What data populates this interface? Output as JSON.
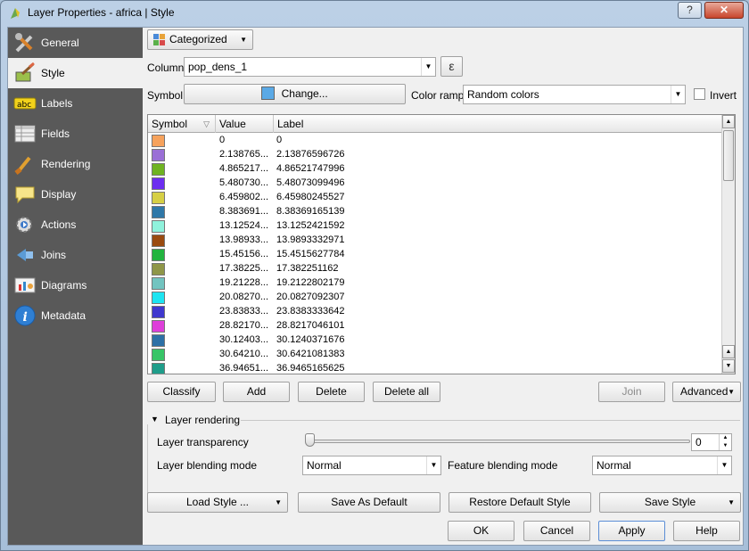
{
  "window": {
    "title": "Layer Properties - africa | Style",
    "help_label": "?",
    "close_label": "✕"
  },
  "sidebar": {
    "items": [
      {
        "label": "General",
        "icon": "general-icon"
      },
      {
        "label": "Style",
        "icon": "style-icon"
      },
      {
        "label": "Labels",
        "icon": "labels-icon"
      },
      {
        "label": "Fields",
        "icon": "fields-icon"
      },
      {
        "label": "Rendering",
        "icon": "rendering-icon"
      },
      {
        "label": "Display",
        "icon": "display-icon"
      },
      {
        "label": "Actions",
        "icon": "actions-icon"
      },
      {
        "label": "Joins",
        "icon": "joins-icon"
      },
      {
        "label": "Diagrams",
        "icon": "diagrams-icon"
      },
      {
        "label": "Metadata",
        "icon": "metadata-icon"
      }
    ],
    "active": "Style"
  },
  "renderer": {
    "type": "Categorized"
  },
  "column": {
    "label": "Column",
    "value": "pop_dens_1",
    "expression_label": "ε"
  },
  "symbol": {
    "label": "Symbol",
    "change_label": "Change...",
    "color": "#5aa9e6"
  },
  "color_ramp": {
    "label": "Color ramp",
    "value": "Random colors",
    "invert_label": "Invert",
    "invert_checked": false
  },
  "table": {
    "headers": [
      "Symbol",
      "Value",
      "Label"
    ],
    "rows": [
      {
        "color": "#f6a25c",
        "value": "0",
        "label": "0"
      },
      {
        "color": "#9a6fd6",
        "value": "2.138765...",
        "label": "2.13876596726"
      },
      {
        "color": "#6fb320",
        "value": "4.865217...",
        "label": "4.86521747996"
      },
      {
        "color": "#6c2df0",
        "value": "5.480730...",
        "label": "5.48073099496"
      },
      {
        "color": "#d6cf45",
        "value": "6.459802...",
        "label": "6.45980245527"
      },
      {
        "color": "#2f78a8",
        "value": "8.383691...",
        "label": "8.38369165139"
      },
      {
        "color": "#8ff2dc",
        "value": "13.12524...",
        "label": "13.1252421592"
      },
      {
        "color": "#9a4a10",
        "value": "13.98933...",
        "label": "13.9893332971"
      },
      {
        "color": "#22b43f",
        "value": "15.45156...",
        "label": "15.4515627784"
      },
      {
        "color": "#8f9648",
        "value": "17.38225...",
        "label": "17.382251162"
      },
      {
        "color": "#72c4c0",
        "value": "19.21228...",
        "label": "19.2122802179"
      },
      {
        "color": "#1de4f1",
        "value": "20.08270...",
        "label": "20.0827092307"
      },
      {
        "color": "#3f38ce",
        "value": "23.83833...",
        "label": "23.8383333642"
      },
      {
        "color": "#de3fda",
        "value": "28.82170...",
        "label": "28.8217046101"
      },
      {
        "color": "#2c70a6",
        "value": "30.12403...",
        "label": "30.1240371676"
      },
      {
        "color": "#37c567",
        "value": "30.64210...",
        "label": "30.6421081383"
      },
      {
        "color": "#1f9d8a",
        "value": "36.94651...",
        "label": "36.9465165625"
      }
    ]
  },
  "actions": {
    "classify": "Classify",
    "add": "Add",
    "delete": "Delete",
    "delete_all": "Delete all",
    "join": "Join",
    "advanced": "Advanced"
  },
  "layer_rendering": {
    "title": "Layer rendering",
    "transparency_label": "Layer transparency",
    "transparency_value": "0",
    "blending_label": "Layer blending mode",
    "blending_value": "Normal",
    "feature_blending_label": "Feature blending mode",
    "feature_blending_value": "Normal"
  },
  "style_buttons": {
    "load": "Load Style ...",
    "save_default": "Save As Default",
    "restore_default": "Restore Default Style",
    "save": "Save Style"
  },
  "dialog_buttons": {
    "ok": "OK",
    "cancel": "Cancel",
    "apply": "Apply",
    "help": "Help"
  }
}
